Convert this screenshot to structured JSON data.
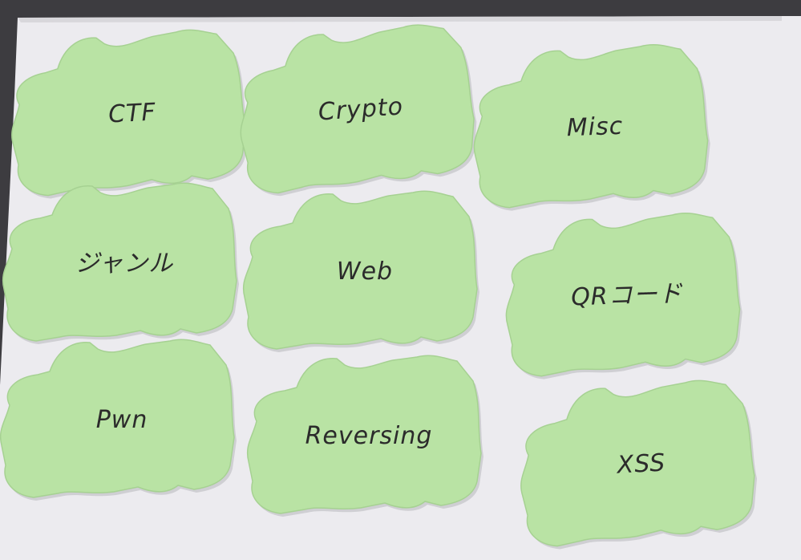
{
  "colors": {
    "background": "#3d3c40",
    "paper": "#ecebef",
    "note": "#b9e3a4",
    "note_edge": "#a6d192",
    "ink": "#2b2b2b"
  },
  "notes": [
    {
      "label": "CTF"
    },
    {
      "label": "Crypto"
    },
    {
      "label": "Misc"
    },
    {
      "label": "ジャンル"
    },
    {
      "label": "Web"
    },
    {
      "label": "QRコード"
    },
    {
      "label": "Pwn"
    },
    {
      "label": "Reversing"
    },
    {
      "label": "XSS"
    }
  ]
}
